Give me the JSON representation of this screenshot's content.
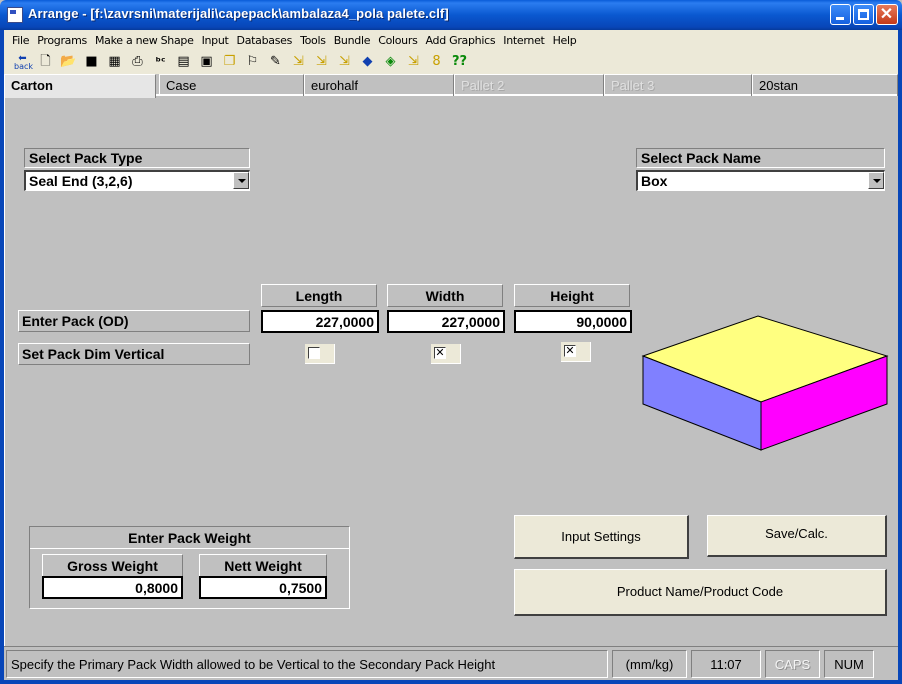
{
  "window": {
    "title": "Arrange - [f:\\zavrsni\\materijali\\capepack\\ambalaza4_pola palete.clf]"
  },
  "menu": [
    "File",
    "Programs",
    "Make a new Shape",
    "Input",
    "Databases",
    "Tools",
    "Bundle",
    "Colours",
    "Add Graphics",
    "Internet",
    "Help"
  ],
  "toolbar": {
    "back_label": "back",
    "icons": [
      "back-icon",
      "new-file-icon",
      "open-folder-icon",
      "save-icon",
      "calculator-icon",
      "print-icon",
      "spell-check-icon",
      "document-icon",
      "image-icon",
      "copy-icon",
      "tree-icon",
      "edit-icon",
      "arrange-icon",
      "arrange2-icon",
      "arrange3-icon",
      "paint-icon",
      "cube-icon",
      "arrange4-icon",
      "bottle-icon",
      "help-icon"
    ],
    "help_label": "??"
  },
  "tabs": [
    {
      "label": "Carton",
      "state": "active"
    },
    {
      "label": "Case",
      "state": "normal"
    },
    {
      "label": "eurohalf",
      "state": "normal"
    },
    {
      "label": "Pallet 2",
      "state": "disabled"
    },
    {
      "label": "Pallet 3",
      "state": "disabled"
    },
    {
      "label": "20stan",
      "state": "normal"
    }
  ],
  "pack_type": {
    "label": "Select Pack Type",
    "value": "Seal End (3,2,6)"
  },
  "pack_name": {
    "label": "Select Pack Name",
    "value": "Box"
  },
  "dimensions": {
    "headers": [
      "Length",
      "Width",
      "Height"
    ],
    "od_label": "Enter Pack (OD)",
    "values": [
      "227,0000",
      "227,0000",
      "90,0000"
    ],
    "vertical_label": "Set Pack Dim Vertical",
    "vertical_checks": [
      false,
      true,
      true
    ]
  },
  "weight": {
    "title": "Enter Pack Weight",
    "gross_label": "Gross Weight",
    "gross_value": "0,8000",
    "nett_label": "Nett Weight",
    "nett_value": "0,7500"
  },
  "buttons": {
    "input_settings": "Input Settings",
    "save_calc": "Save/Calc.",
    "product_name_code": "Product Name/Product Code"
  },
  "box_colors": {
    "top": "#ffff80",
    "left": "#8080ff",
    "right": "#ff00ff"
  },
  "status": {
    "message": "Specify the Primary Pack Width allowed to be Vertical to the Secondary Pack Height",
    "units": "(mm/kg)",
    "time": "11:07",
    "caps": "CAPS",
    "num": "NUM"
  }
}
